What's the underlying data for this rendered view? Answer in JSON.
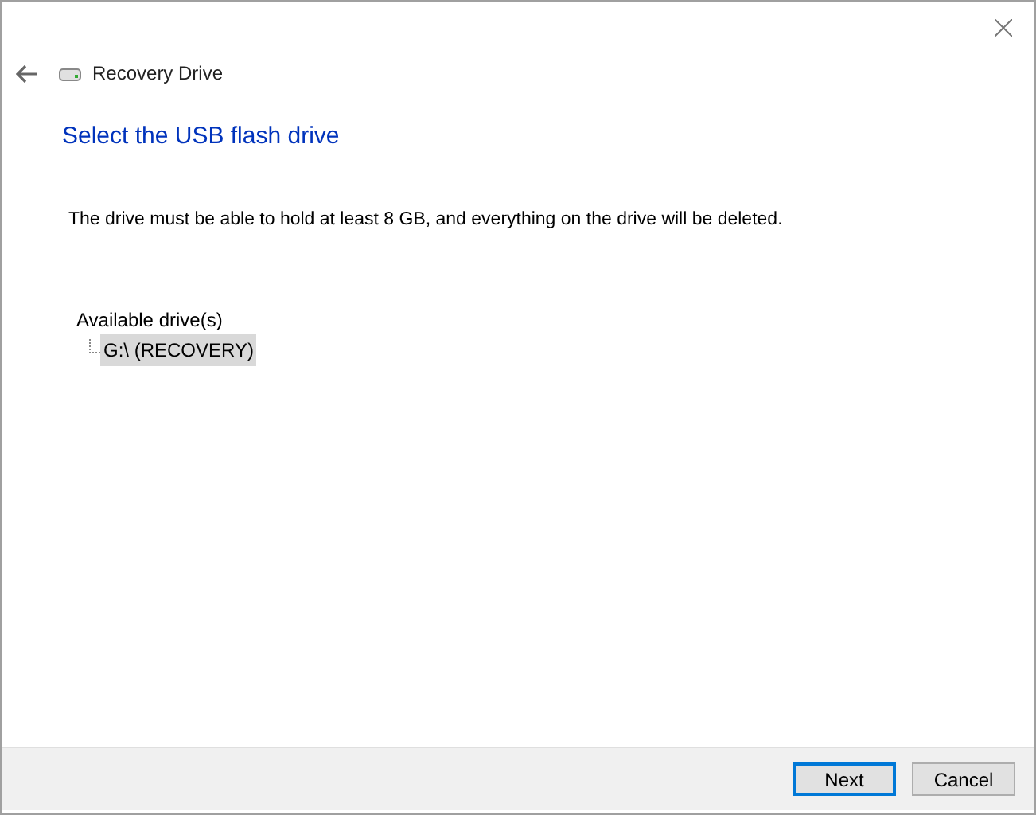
{
  "window": {
    "title": "Recovery Drive"
  },
  "heading": "Select the USB flash drive",
  "description": "The drive must be able to hold at least 8 GB, and everything on the drive will be deleted.",
  "drives": {
    "label": "Available drive(s)",
    "items": [
      {
        "label": "G:\\ (RECOVERY)",
        "selected": true
      }
    ]
  },
  "buttons": [
    {
      "label": "Next",
      "default": true
    },
    {
      "label": "Cancel",
      "default": false
    }
  ]
}
